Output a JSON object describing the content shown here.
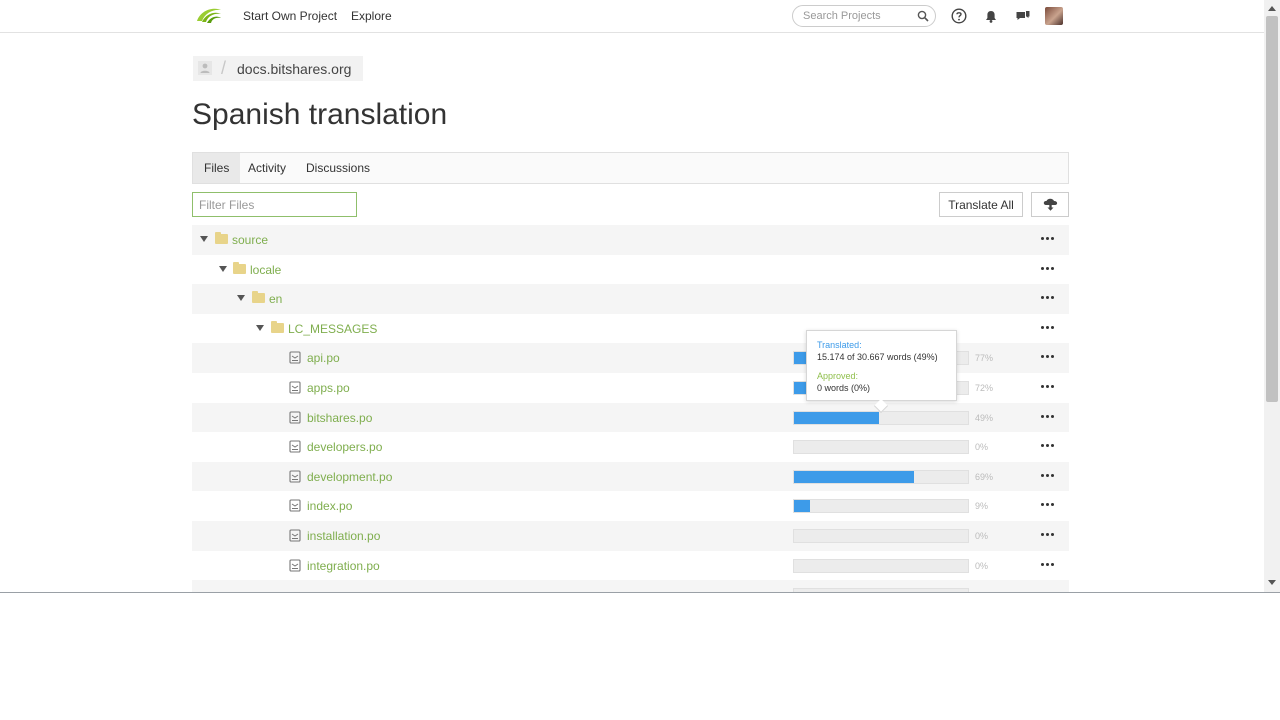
{
  "nav": {
    "start_project": "Start Own Project",
    "explore": "Explore",
    "search_placeholder": "Search Projects"
  },
  "breadcrumb": {
    "project": "docs.bitshares.org"
  },
  "page": {
    "title": "Spanish translation"
  },
  "tabs": [
    {
      "label": "Files",
      "active": true
    },
    {
      "label": "Activity",
      "active": false
    },
    {
      "label": "Discussions",
      "active": false
    }
  ],
  "toolbar": {
    "filter_placeholder": "Filter Files",
    "translate_all": "Translate All"
  },
  "tree": {
    "folders": [
      {
        "name": "source",
        "depth": 0
      },
      {
        "name": "locale",
        "depth": 1
      },
      {
        "name": "en",
        "depth": 2
      },
      {
        "name": "LC_MESSAGES",
        "depth": 3
      }
    ],
    "files": [
      {
        "name": "api.po",
        "percent": 77,
        "percent_label": "77%"
      },
      {
        "name": "apps.po",
        "percent": 72,
        "percent_label": "72%"
      },
      {
        "name": "bitshares.po",
        "percent": 49,
        "percent_label": "49%"
      },
      {
        "name": "developers.po",
        "percent": 0,
        "percent_label": "0%"
      },
      {
        "name": "development.po",
        "percent": 69,
        "percent_label": "69%"
      },
      {
        "name": "index.po",
        "percent": 9,
        "percent_label": "9%"
      },
      {
        "name": "installation.po",
        "percent": 0,
        "percent_label": "0%"
      },
      {
        "name": "integration.po",
        "percent": 0,
        "percent_label": "0%"
      }
    ]
  },
  "tooltip": {
    "translated_label": "Translated:",
    "translated_value": "15.174 of 30.667 words (49%)",
    "approved_label": "Approved:",
    "approved_value": "0 words (0%)"
  },
  "colors": {
    "accent_green": "#7fae4e",
    "progress_blue": "#3d9be9",
    "folder_yellow": "#e8d48a"
  },
  "icons": [
    "logo-icon",
    "search-icon",
    "help-icon",
    "bell-icon",
    "chat-icon",
    "user-icon",
    "download-icon",
    "folder-icon",
    "file-icon",
    "more-icon",
    "chevron-down-icon"
  ]
}
